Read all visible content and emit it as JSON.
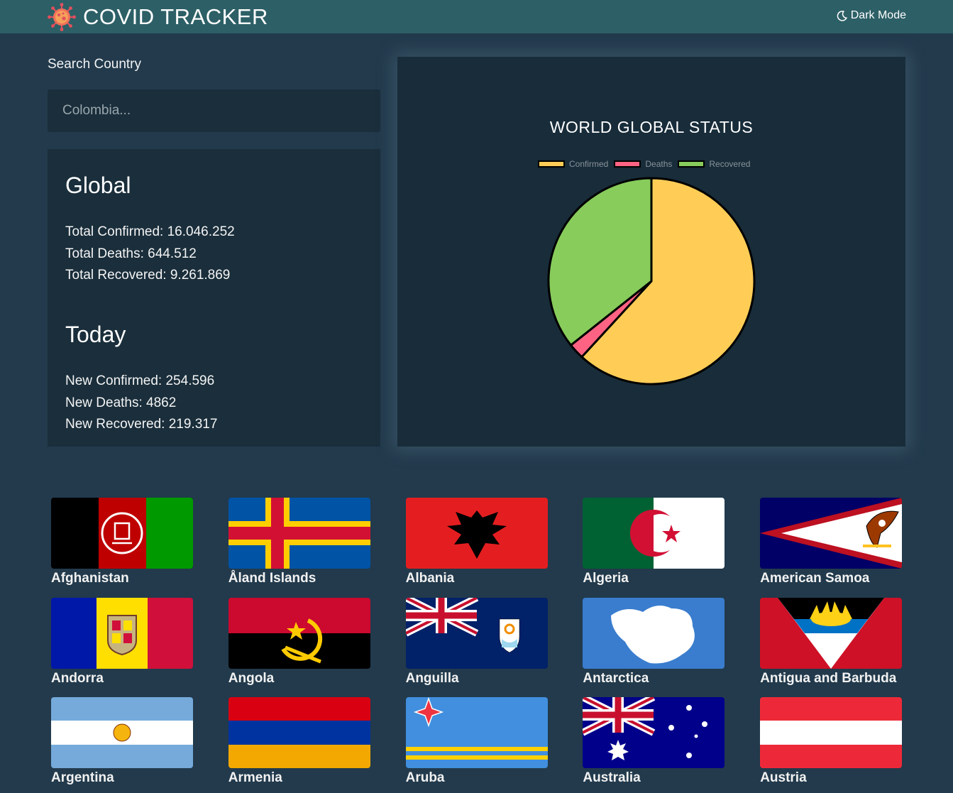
{
  "header": {
    "title": "COVID TRACKER",
    "dark_mode_label": "Dark Mode"
  },
  "search": {
    "label": "Search Country",
    "placeholder": "Colombia..."
  },
  "global": {
    "heading": "Global",
    "total_confirmed": "Total Confirmed: 16.046.252",
    "total_deaths": "Total Deaths: 644.512",
    "total_recovered": "Total Recovered: 9.261.869"
  },
  "today": {
    "heading": "Today",
    "new_confirmed": "New Confirmed: 254.596",
    "new_deaths": "New Deaths: 4862",
    "new_recovered": "New Recovered: 219.317"
  },
  "chart_data": {
    "type": "pie",
    "title": "WORLD GLOBAL STATUS",
    "categories": [
      "Confirmed",
      "Deaths",
      "Recovered"
    ],
    "values": [
      16046252,
      644512,
      9261869
    ],
    "colors": [
      "#ffcd56",
      "#ff6384",
      "#88cc5c"
    ],
    "legend": "top"
  },
  "countries": [
    {
      "name": "Afghanistan",
      "flag": "af"
    },
    {
      "name": "Åland Islands",
      "flag": "ax"
    },
    {
      "name": "Albania",
      "flag": "al"
    },
    {
      "name": "Algeria",
      "flag": "dz"
    },
    {
      "name": "American Samoa",
      "flag": "as"
    },
    {
      "name": "Andorra",
      "flag": "ad"
    },
    {
      "name": "Angola",
      "flag": "ao"
    },
    {
      "name": "Anguilla",
      "flag": "ai"
    },
    {
      "name": "Antarctica",
      "flag": "aq"
    },
    {
      "name": "Antigua and Barbuda",
      "flag": "ag"
    },
    {
      "name": "Argentina",
      "flag": "ar"
    },
    {
      "name": "Armenia",
      "flag": "am"
    },
    {
      "name": "Aruba",
      "flag": "aw"
    },
    {
      "name": "Australia",
      "flag": "au"
    },
    {
      "name": "Austria",
      "flag": "at"
    }
  ]
}
